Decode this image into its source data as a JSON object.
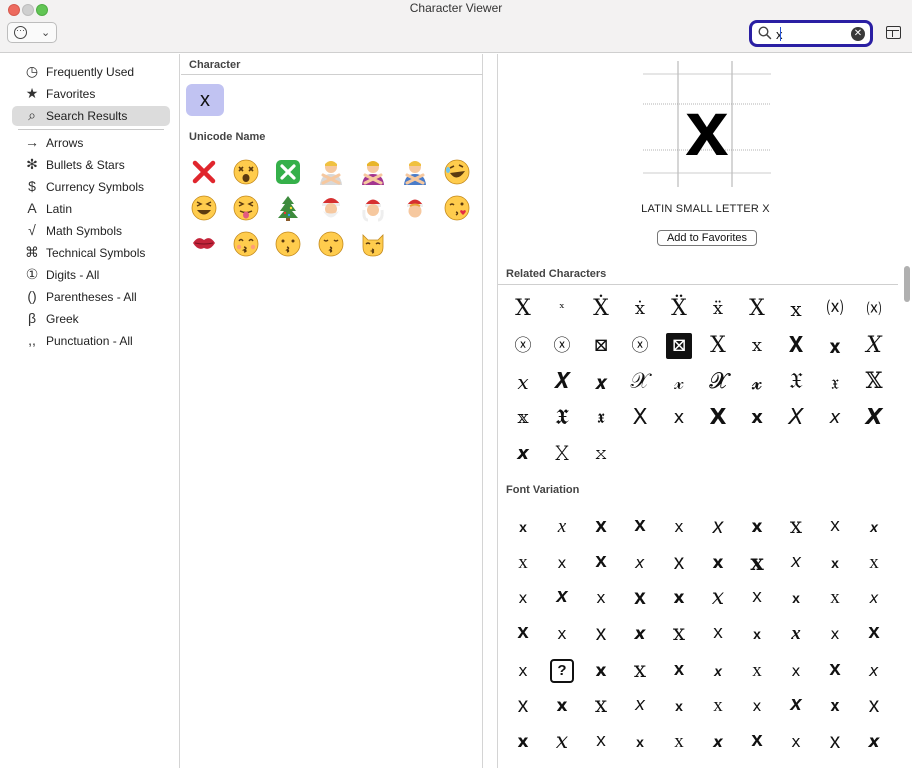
{
  "window": {
    "title": "Character Viewer"
  },
  "toolbar": {
    "action_icon": "ellipsis-circle-icon",
    "search": {
      "value": "x",
      "placeholder": "Search"
    }
  },
  "sidebar": {
    "items": [
      {
        "label": "Frequently Used",
        "icon": "clock-icon",
        "glyph": "◷"
      },
      {
        "label": "Favorites",
        "icon": "star-icon",
        "glyph": "★"
      },
      {
        "label": "Search Results",
        "icon": "magnifier-icon",
        "glyph": "⌕",
        "selected": true
      },
      {
        "label": "Arrows",
        "icon": "arrow-icon",
        "glyph": "→"
      },
      {
        "label": "Bullets & Stars",
        "icon": "asterisk-icon",
        "glyph": "✻"
      },
      {
        "label": "Currency Symbols",
        "icon": "dollar-icon",
        "glyph": "$"
      },
      {
        "label": "Latin",
        "icon": "latin-a-icon",
        "glyph": "A"
      },
      {
        "label": "Math Symbols",
        "icon": "square-root-icon",
        "glyph": "√"
      },
      {
        "label": "Technical Symbols",
        "icon": "command-icon",
        "glyph": "⌘"
      },
      {
        "label": "Digits - All",
        "icon": "circled-one-icon",
        "glyph": "①"
      },
      {
        "label": "Parentheses - All",
        "icon": "parentheses-icon",
        "glyph": "()"
      },
      {
        "label": "Greek",
        "icon": "beta-icon",
        "glyph": "β"
      },
      {
        "label": "Punctuation - All",
        "icon": "commas-icon",
        "glyph": ",,"
      }
    ]
  },
  "middle": {
    "character_header": "Character",
    "selected_character": "x",
    "unicode_name_header": "Unicode Name",
    "emoji_results": [
      "cross-mark",
      "dizzy-face",
      "cross-mark-button",
      "person-gesturing-no",
      "person-gesturing-no-purple",
      "person-gesturing-no-blue",
      "rolling-on-floor-laughing",
      "grinning-squinting-face",
      "squinting-tongue-face",
      "christmas-tree",
      "santa-claus",
      "mrs-claus",
      "mx-claus",
      "face-blowing-kiss",
      "kiss-mark",
      "kissing-smiling-eyes",
      "kissing-face",
      "kissing-closed-eyes",
      "kissing-cat"
    ]
  },
  "detail": {
    "glyph": "x",
    "name": "LATIN SMALL LETTER X",
    "favorites_button": "Add to Favorites",
    "related_header": "Related Characters",
    "related": [
      "X",
      "ˣ",
      "Ẋ",
      "ẋ",
      "Ẍ",
      "ẍ",
      "Χ",
      "х",
      "⒳",
      "⒳",
      "ⓧ",
      "ⓧ",
      "⊠",
      "ⓧ",
      "⊠",
      "X",
      "x",
      "𝐗",
      "𝐱",
      "𝑋",
      "𝑥",
      "𝑿",
      "𝒙",
      "𝒳",
      "𝓍",
      "𝓧",
      "𝔁",
      "𝔛",
      "𝔵",
      "𝕏",
      "𝕩",
      "𝖃",
      "𝖝",
      "𝖷",
      "𝗑",
      "𝗫",
      "𝘅",
      "𝘟",
      "𝘹",
      "𝙓",
      "𝙭",
      "𝚇",
      "𝚡"
    ],
    "font_variation_header": "Font Variation",
    "font_variations": [
      "x",
      "x",
      "X",
      "x",
      "x",
      "x",
      "x",
      "x",
      "x",
      "x",
      "x",
      "x",
      "x",
      "x",
      "x",
      "x",
      "x",
      "x",
      "x",
      "x",
      "x",
      "x",
      "x",
      "x",
      "x",
      "x",
      "x",
      "x",
      "x",
      "x",
      "x",
      "x",
      "x",
      "x",
      "x",
      "x",
      "x",
      "x",
      "x",
      "x",
      "x",
      "?",
      "x",
      "x",
      "x",
      "x",
      "x",
      "x",
      "x",
      "x",
      "x",
      "x",
      "x",
      "x",
      "x",
      "x",
      "x",
      "x",
      "x",
      "x",
      "x",
      "x",
      "x",
      "x",
      "x",
      "x",
      "x",
      "x",
      "x",
      "x"
    ]
  }
}
